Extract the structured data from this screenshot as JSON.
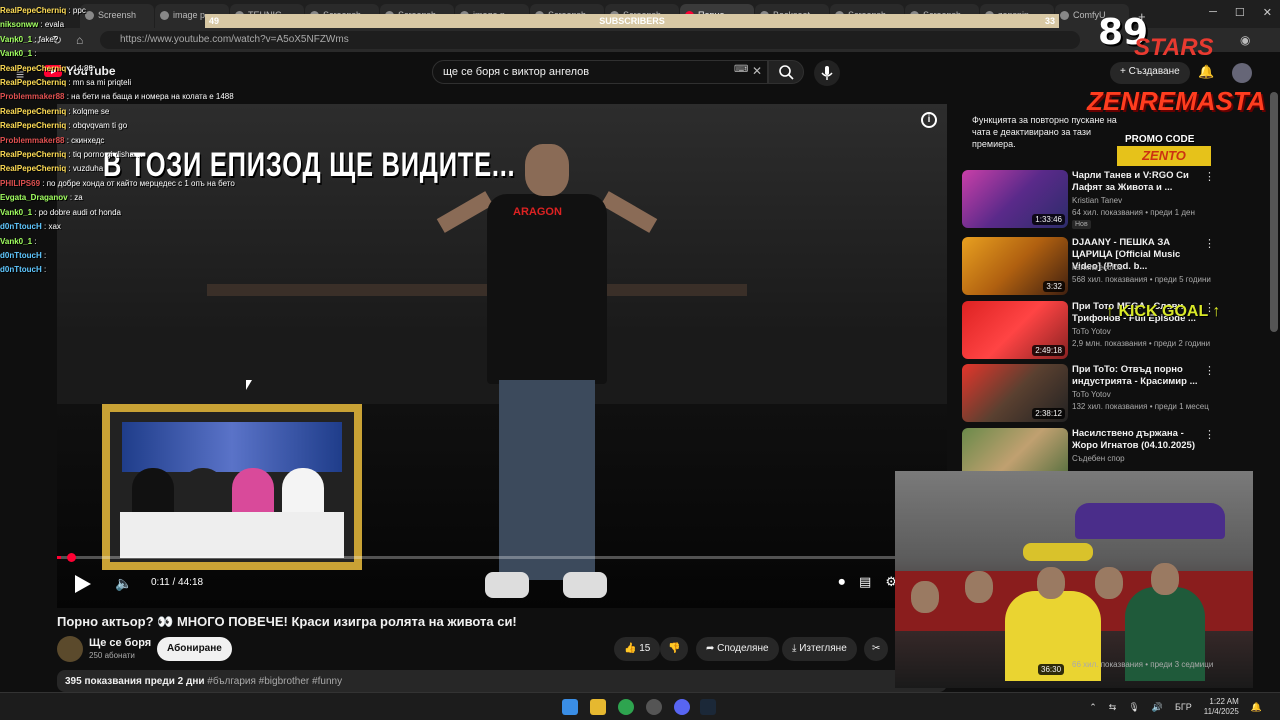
{
  "browser": {
    "tabs": [
      "Screensh",
      "image p",
      "TEHNIC",
      "Screensh",
      "Screensh",
      "image p",
      "Screensh",
      "Screensh",
      "Порно",
      "Backseat",
      "Screensh",
      "Screensh",
      "zenspin",
      "ComfyU"
    ],
    "active_tab_index": 8,
    "url": "https://www.youtube.com/watch?v=A5oX5NFZWms",
    "new_tab": "+"
  },
  "subscriber_bar": {
    "label": "SUBSCRIBERS",
    "left_value": "49",
    "right_value": "33"
  },
  "youtube": {
    "logo_text": "YouTube",
    "search_query": "ще се боря с виктор ангелов",
    "create_label": "Създаване"
  },
  "chat": [
    {
      "user": "RealPepeCherniq",
      "msg": "ppc",
      "color": "#ffdd55"
    },
    {
      "user": "nikson​ww",
      "msg": "evala",
      "color": "#a0ff60"
    },
    {
      "user": "Vank0_1",
      "msg": "fake?",
      "color": "#a0ff60"
    },
    {
      "user": "Vank0_1",
      "msg": "",
      "color": "#a0ff60"
    },
    {
      "user": "RealPepeCherniq",
      "msg": "14:88",
      "color": "#ffdd55"
    },
    {
      "user": "RealPepeCherniq",
      "msg": "mn sa mi priqteli",
      "color": "#ffdd55"
    },
    {
      "user": "Problemmaker88",
      "msg": "на бети на баща и номера на колата е 1488",
      "color": "#e05050"
    },
    {
      "user": "RealPepeCherniq",
      "msg": "kolqme se",
      "color": "#ffdd55"
    },
    {
      "user": "RealPepeCherniq",
      "msg": "obqvqvam ti go",
      "color": "#ffdd55"
    },
    {
      "user": "Problemmaker88",
      "msg": "скинхедс",
      "color": "#e05050"
    },
    {
      "user": "RealPepeCherniq",
      "msg": "tiq porno gi disha....",
      "color": "#ffdd55"
    },
    {
      "user": "RealPepeCherniq",
      "msg": "vuzduha",
      "color": "#ffdd55"
    },
    {
      "user": "PHILIPS69",
      "msg": "по добре хонда от кайто мерцедес с 1 опъ на бето",
      "color": "#e05050"
    },
    {
      "user": "Evgata_Draganov",
      "msg": "za",
      "color": "#a0ff60"
    },
    {
      "user": "Vank0_1",
      "msg": "po dobre audi ot honda",
      "color": "#a0ff60"
    },
    {
      "user": "d0nTtoucH",
      "msg": "xax",
      "color": "#60c8ff"
    },
    {
      "user": "Vank0_1",
      "msg": "",
      "color": "#a0ff60"
    },
    {
      "user": "d0nTtoucH",
      "msg": "",
      "color": "#60c8ff"
    },
    {
      "user": "d0nTtoucH",
      "msg": "",
      "color": "#60c8ff"
    }
  ],
  "video": {
    "caption": "В ТОЗИ ЕПИЗОД ЩЕ ВИДИТЕ...",
    "shirt_text": "ARAGON",
    "current_time": "0:11",
    "duration": "44:18",
    "time_display": "0:11 / 44:18",
    "progress_fraction": 0.004,
    "title": "Порно актьор? 👀 МНОГО ПОВЕЧЕ! Краси изигра ролята на живота си!"
  },
  "channel": {
    "name": "Ще се боря",
    "subscribers": "250 абонати",
    "subscribe_label": "Абониране"
  },
  "actions": {
    "likes": "15",
    "share": "Споделяне",
    "download": "Изтегляне"
  },
  "description": {
    "views_date": "395 показвания  преди 2 дни",
    "tags": "#българия #bigbrother #funny"
  },
  "sidebar": {
    "notice": "Функцията за повторно пускане на чата е деактивирано за тази премиера.",
    "items": [
      {
        "title": "Чарли Танев и V:RGO Си Лафят за Живота и ...",
        "channel": "Kristian Tanev",
        "meta": "64 хил. показвания • преди 1 ден",
        "duration": "1:33:46",
        "badge": "Нов"
      },
      {
        "title": "DJAANY - ПЕШКА ЗА ЦАРИЦА [Official Music Video] (Prod. b...",
        "channel": "kartelarecords",
        "meta": "568 хил. показвания • преди 5 години",
        "duration": "3:32",
        "badge": ""
      },
      {
        "title": "При Тото MEGA - Слави Трифонов - Full Episode ...",
        "channel": "ToTo Yotov",
        "meta": "2,9 млн. показвания • преди 2 години",
        "duration": "2:49:18",
        "badge": ""
      },
      {
        "title": "При ToTo: Отвъд порно индустрията - Красимир ...",
        "channel": "ToTo Yotov",
        "meta": "132 хил. показвания • преди 1 месец",
        "duration": "2:38:12",
        "badge": ""
      },
      {
        "title": "Насилствено държана - Жоро Игнатов (04.10.2025)",
        "channel": "Съдебен спор",
        "meta": "",
        "duration": "",
        "badge": ""
      }
    ],
    "last_meta": "66 хил. показвания • преди 3 седмици",
    "last_duration": "36:30"
  },
  "overlays": {
    "brand_number": "89",
    "brand_word": "STARS",
    "sponsor": "ZENREMASTA",
    "promo_label": "PROMO CODE",
    "promo_code": "ZENTO",
    "kick_goal": "KICK GOAL"
  },
  "taskbar": {
    "language": "БГР",
    "time": "1:22 AM",
    "date": "11/4/2025"
  },
  "colors": {
    "youtube_red": "#ff0033",
    "background": "#0f0f0f",
    "subscriber_bar": "#d8c8a4",
    "frame_gold": "#c9a235",
    "promo_yellow": "#e6c21a"
  }
}
